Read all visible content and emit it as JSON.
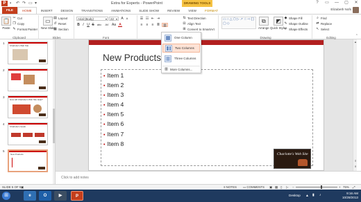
{
  "window": {
    "title": "Extra for Experts - PowerPoint",
    "contextual_header": "DRAWING TOOLS",
    "controls": [
      "?",
      "▭",
      "—",
      "▢",
      "✕"
    ]
  },
  "tabs": [
    "FILE",
    "HOME",
    "INSERT",
    "DESIGN",
    "TRANSITIONS",
    "ANIMATIONS",
    "SLIDE SHOW",
    "REVIEW",
    "VIEW",
    "FORMAT"
  ],
  "active_tab": "HOME",
  "user": {
    "name": "Elizabeth Nofs"
  },
  "ribbon": {
    "clipboard": {
      "label": "Clipboard",
      "paste": "Paste",
      "cut": "Cut",
      "copy": "Copy",
      "format_painter": "Format Painter"
    },
    "slides": {
      "label": "Slides",
      "new_slide": "New Slide",
      "layout": "Layout",
      "reset": "Reset",
      "section": "Section"
    },
    "font": {
      "label": "Font",
      "font_name": "Arial (Body)",
      "font_size": "22",
      "bold": "B",
      "italic": "I",
      "underline": "U",
      "strike": "S",
      "shadow": "abc",
      "spacing": "AV",
      "case": "Aa",
      "color": "A",
      "grow": "A",
      "shrink": "A"
    },
    "paragraph": {
      "text_direction": "Text Direction",
      "align_text": "Align Text",
      "smartart": "Convert to SmartArt"
    },
    "drawing": {
      "label": "Drawing",
      "arrange": "Arrange",
      "quick_styles": "Quick Styles",
      "shape_fill": "Shape Fill",
      "shape_outline": "Shape Outline",
      "shape_effects": "Shape Effects"
    },
    "editing": {
      "label": "Editing",
      "find": "Find",
      "replace": "Replace",
      "select": "Select"
    }
  },
  "columns_menu": {
    "items": [
      "One Column",
      "Two Columns",
      "Three Columns"
    ],
    "highlighted": "Two Columns",
    "more": "More Columns..."
  },
  "thumbnails": [
    {
      "num": "1",
      "title": "Charlotte's Web Site"
    },
    {
      "num": "2",
      "title": ""
    },
    {
      "num": "3",
      "title": "How will Charlotte's Web Site Help?"
    },
    {
      "num": "4",
      "title": "Charlotte's Goals"
    },
    {
      "num": "5",
      "title": "New Products"
    }
  ],
  "slide": {
    "title": "New Products",
    "bullets": [
      "Item 1",
      "Item 2",
      "Item 3",
      "Item 4",
      "Item 5",
      "Item 6",
      "Item 7",
      "Item 8"
    ],
    "logo_text": "Charlotte's Web Site"
  },
  "notes_placeholder": "Click to add notes",
  "status": {
    "slide_of": "SLIDE 5 OF 5",
    "notes": "NOTES",
    "comments": "COMMENTS",
    "zoom": "75%"
  },
  "taskbar": {
    "desktop": "Desktop",
    "time": "9:16 AM",
    "date": "10/28/2013"
  },
  "colors": {
    "accent": "#c43e1c",
    "slide_bar": "#b21f1f",
    "bullet": "#c00000",
    "drawing_tools": "#f5c242",
    "taskbar": "#1f3a5f"
  }
}
